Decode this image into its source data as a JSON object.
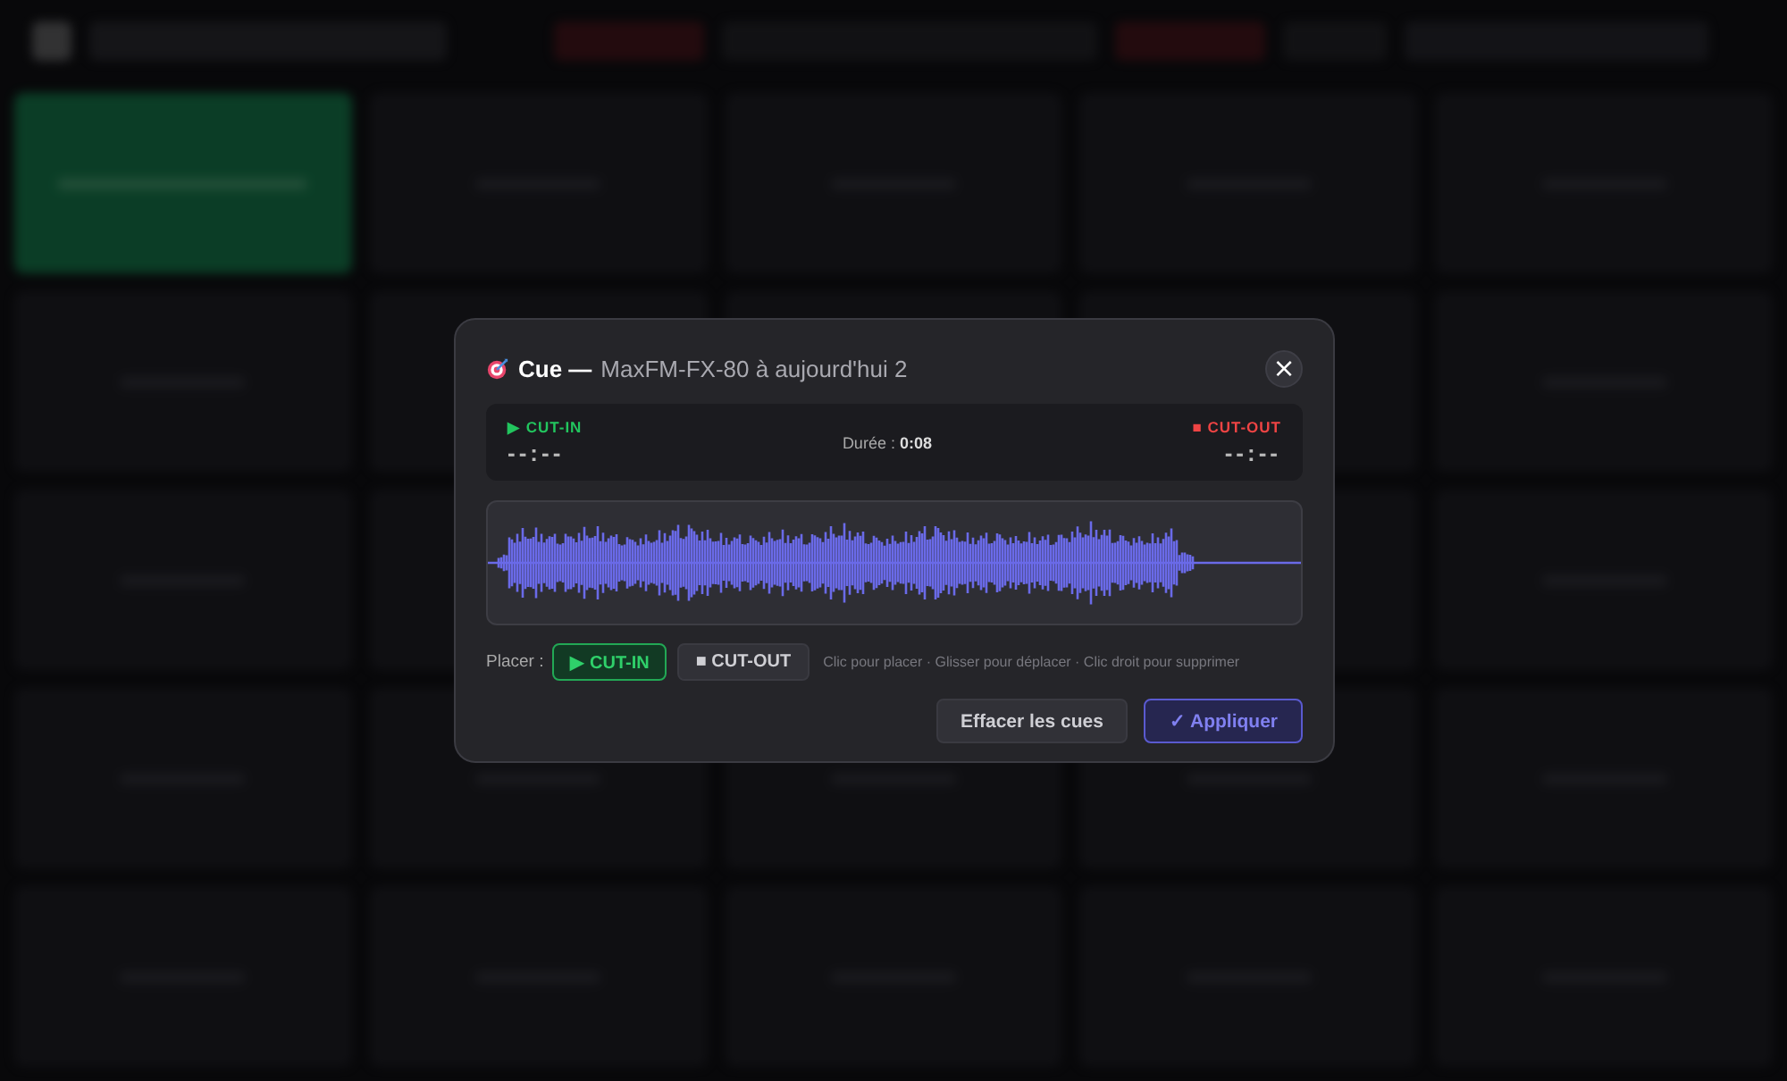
{
  "dialog": {
    "title": "Cue —",
    "subtitle": "MaxFM-FX-80 à aujourd'hui 2",
    "close": "×",
    "cut_in": {
      "label": "▶ CUT-IN",
      "time": "--:--"
    },
    "duration": "Durée : **0:08**",
    "cut_out": {
      "label": "■ CUT-OUT",
      "time": "--:--"
    },
    "place_label": "Placer :",
    "place_modes": [
      {
        "label": "▶ CUT-IN",
        "kind": "in",
        "selected": true
      },
      {
        "label": "■ CUT-OUT",
        "kind": "out",
        "selected": false
      }
    ],
    "hint": "Clic pour placer · Glisser pour déplacer · Clic droit pour supprimer",
    "buttons": [
      {
        "label": "Effacer les cues",
        "kind": "secondary"
      },
      {
        "label": "✓ Appliquer",
        "kind": "primary"
      }
    ]
  }
}
